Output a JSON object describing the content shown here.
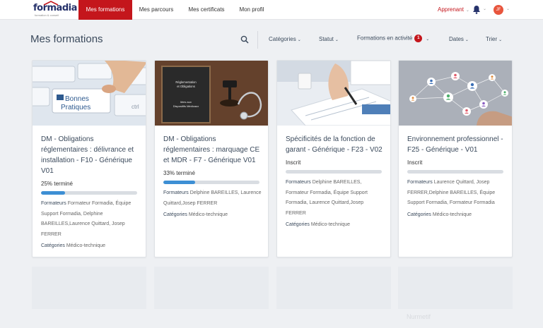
{
  "brand": {
    "name": "formadia",
    "tagline": "formation & conseil",
    "accent": "#c4161c"
  },
  "nav": {
    "items": [
      {
        "label": "Mes formations",
        "active": true
      },
      {
        "label": "Mes parcours",
        "active": false
      },
      {
        "label": "Mes certificats",
        "active": false
      },
      {
        "label": "Mon profil",
        "active": false
      }
    ],
    "role": "Apprenant",
    "avatar_initials": "JF",
    "notification_icon": "bell-icon"
  },
  "page": {
    "title": "Mes formations"
  },
  "toolbar": {
    "search_icon": "search-icon",
    "filters": [
      {
        "label": "Catégories"
      },
      {
        "label": "Statut"
      },
      {
        "label": "Formations en activité",
        "badge": "1"
      },
      {
        "label": "Dates"
      },
      {
        "label": "Trier"
      }
    ]
  },
  "cards": [
    {
      "title": "DM - Obligations réglementaires : délivrance et installation - F10 - Générique V01",
      "status": "25% terminé",
      "progress": 0.25,
      "formateurs_label": "Formateurs",
      "formateurs": "Formateur Formadia, Équipe Support Formadia, Delphine BAREILLES,Laurence Quittard, Josep FERRER",
      "categories_label": "Catégories",
      "categories": "Médico-technique",
      "image": {
        "kind": "keyboard",
        "text1": "Bonnes",
        "text2": "Pratiques",
        "text3": "ctrl"
      }
    },
    {
      "title": "DM - Obligations réglementaires : marquage CE et MDR - F7 - Générique V01",
      "status": "33% terminé",
      "progress": 0.33,
      "formateurs_label": "Formateurs",
      "formateurs": "Delphine BAREILLES, Laurence Quittard,Josep FERRER",
      "categories_label": "Catégories",
      "categories": "Médico-technique",
      "image": {
        "kind": "chalkboard",
        "text1": "Réglementation",
        "text2": "et Obligations",
        "text3": "liées aux",
        "text4": "Dispositifs Médicaux"
      }
    },
    {
      "title": "Spécificités de la fonction de garant - Générique - F23 - V02",
      "status": "Inscrit",
      "progress": 0,
      "formateurs_label": "Formateurs",
      "formateurs": "Delphine BAREILLES, Formateur Formadia, Équipe Support Formadia, Laurence Quittard,Josep FERRER",
      "categories_label": "Catégories",
      "categories": "Médico-technique",
      "image": {
        "kind": "writing"
      }
    },
    {
      "title": "Environnement professionnel - F25 - Générique - V01",
      "status": "Inscrit",
      "progress": 0,
      "formateurs_label": "Formateurs",
      "formateurs": "Laurence Quittard, Josep FERRER,Delphine BAREILLES, Équipe Support Formadia, Formateur Formadia",
      "categories_label": "Catégories",
      "categories": "Médico-technique",
      "image": {
        "kind": "network"
      }
    }
  ],
  "ghost_row": {
    "text": "Nurmetif"
  }
}
